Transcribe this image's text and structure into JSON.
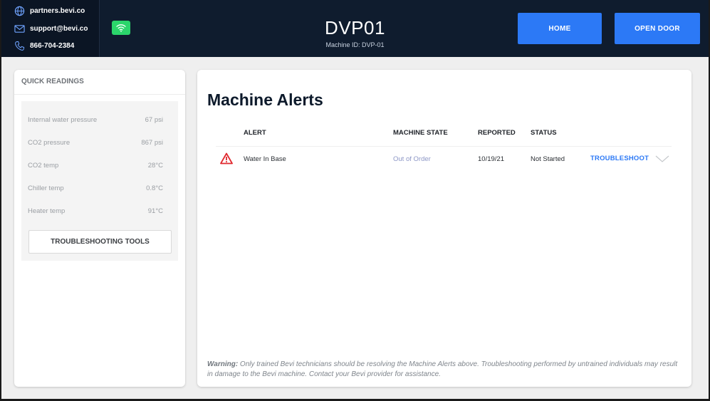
{
  "contact": {
    "website": "partners.bevi.co",
    "email": "support@bevi.co",
    "phone": "866-704-2384"
  },
  "header": {
    "title": "DVP01",
    "machine_id": "Machine ID: DVP-01",
    "home_label": "HOME",
    "open_door_label": "OPEN DOOR"
  },
  "quick_readings": {
    "title": "QUICK READINGS",
    "items": [
      {
        "label": "Internal water pressure",
        "value": "67 psi"
      },
      {
        "label": "CO2 pressure",
        "value": "867 psi"
      },
      {
        "label": "CO2 temp",
        "value": "28°C"
      },
      {
        "label": "Chiller temp",
        "value": "0.8°C"
      },
      {
        "label": "Heater temp",
        "value": "91°C"
      }
    ],
    "tools_label": "TROUBLESHOOTING TOOLS"
  },
  "alerts": {
    "title": "Machine Alerts",
    "columns": {
      "alert": "ALERT",
      "state": "MACHINE STATE",
      "reported": "REPORTED",
      "status": "STATUS"
    },
    "rows": [
      {
        "alert": "Water In Base",
        "state": "Out of Order",
        "reported": "10/19/21",
        "status": "Not Started",
        "action": "TROUBLESHOOT"
      }
    ],
    "warning_bold": "Warning:",
    "warning_text": " Only trained Bevi technicians should be resolving the Machine Alerts above. Troubleshooting performed by untrained individuals may result in damage to the Bevi machine. Contact your Bevi provider for assistance."
  },
  "colors": {
    "header_bg": "#0f1c2e",
    "accent": "#2c79f6",
    "wifi": "#2bd56b",
    "alert_red": "#e0282e"
  },
  "icons": [
    "globe-icon",
    "mail-icon",
    "phone-icon",
    "wifi-icon",
    "warning-icon",
    "chevron-down-icon"
  ]
}
